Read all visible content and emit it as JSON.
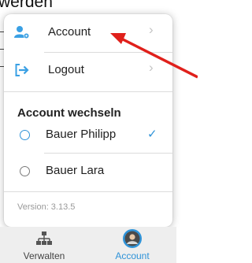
{
  "background": {
    "word": "werden"
  },
  "menu": {
    "items": [
      {
        "label": "Account",
        "icon": "account-settings-icon"
      },
      {
        "label": "Logout",
        "icon": "logout-arrow-icon"
      }
    ],
    "switch_heading": "Account wechseln",
    "accounts": [
      {
        "name": "Bauer Philipp",
        "selected": true
      },
      {
        "name": "Bauer Lara",
        "selected": false
      }
    ],
    "version": "Version: 3.13.5"
  },
  "tabs": [
    {
      "label": "Verwalten",
      "icon": "hierarchy-icon",
      "active": false
    },
    {
      "label": "Account",
      "icon": "avatar-icon",
      "active": true
    }
  ],
  "colors": {
    "accent": "#2f93d8",
    "annotation": "#e0201b",
    "tab_active": "#2f93d8"
  }
}
